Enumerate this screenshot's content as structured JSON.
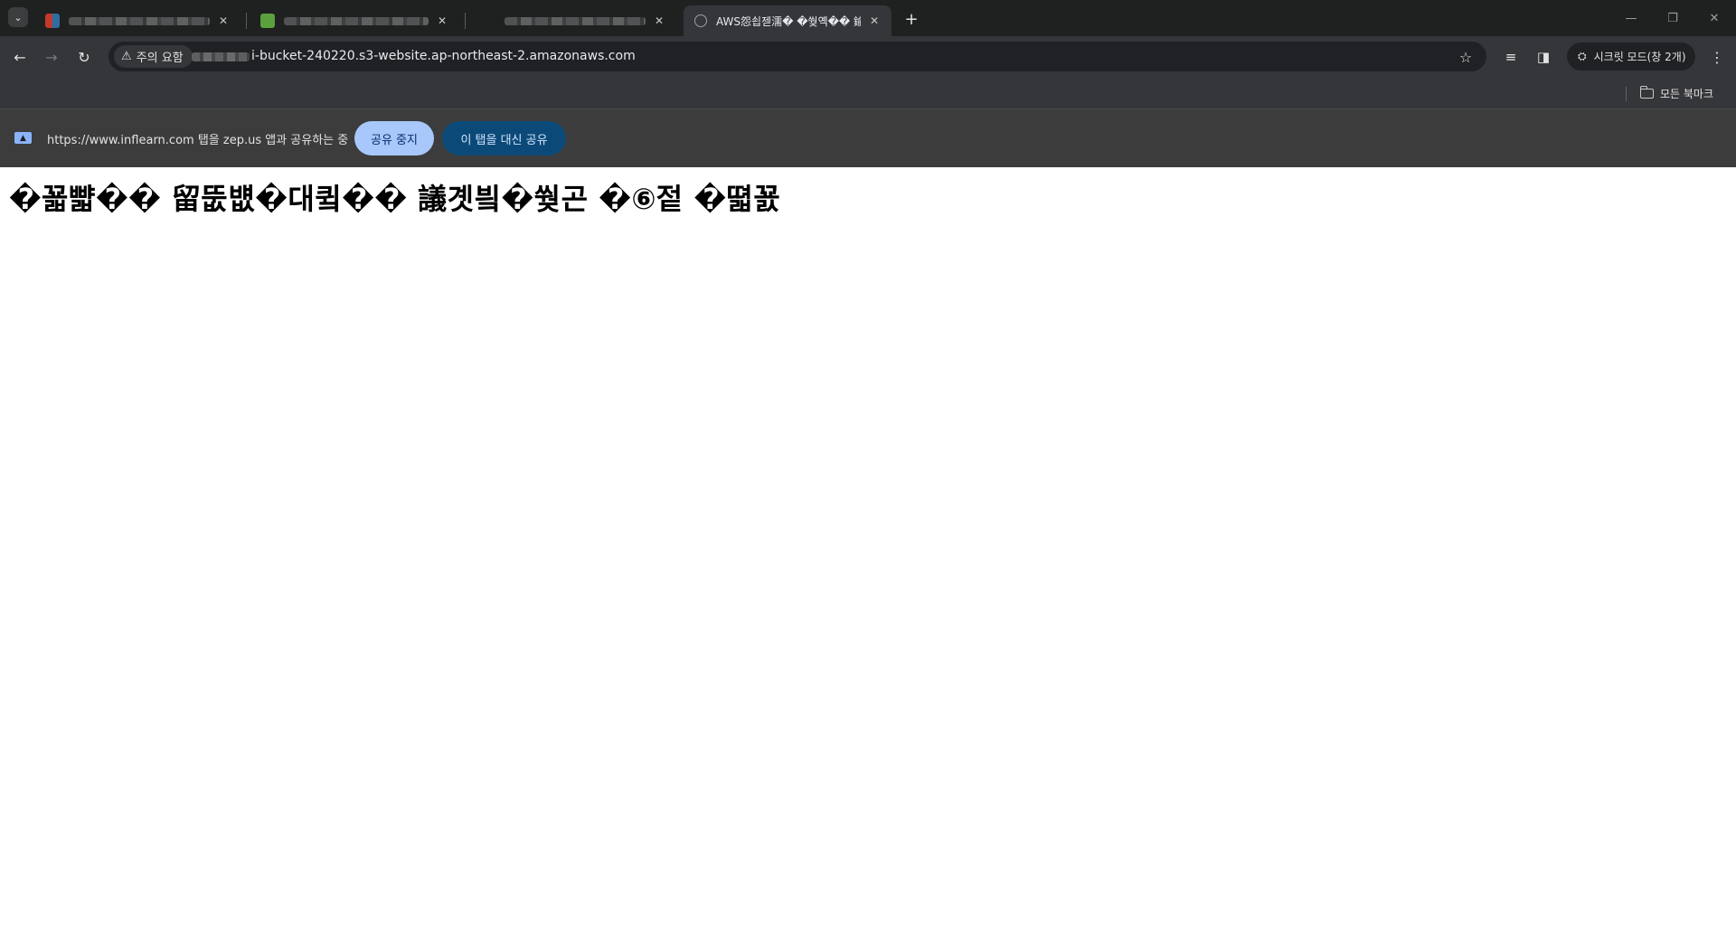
{
  "tabs": [
    {
      "title": "",
      "favicon_color": "#c0392b",
      "blurred": true
    },
    {
      "title": "",
      "favicon_color": "#5aa03c",
      "blurred": true
    },
    {
      "title": "",
      "favicon_color": "",
      "blurred": true
    },
    {
      "title": "AWS怨쇱젣濡� �쒖옉�� 鍮",
      "favicon_color": "",
      "blurred": false,
      "active": true
    }
  ],
  "icons": {
    "tab_search": "⌄",
    "close": "✕",
    "new_tab": "+",
    "minimize": "—",
    "restore": "❐",
    "window_close": "✕",
    "back": "←",
    "forward": "→",
    "reload": "↻",
    "warning": "⚠",
    "star": "☆",
    "media_controls": "≡",
    "side_panel": "◨",
    "incognito": "⛭",
    "menu": "⋮",
    "share_screen": "▲"
  },
  "toolbar": {
    "security_label": "주의 요함",
    "url": "i-bucket-240220.s3-website.ap-northeast-2.amazonaws.com",
    "incognito_label": "시크릿 모드(창 2개)"
  },
  "bookmarks": {
    "all_bookmarks_label": "모든 북마크"
  },
  "infobar": {
    "message": "https://www.inflearn.com 탭을 zep.us 앱과 공유하는 중",
    "stop_button": "공유 중지",
    "share_this_button": "이 탭을 대신 공유"
  },
  "page": {
    "heading": "�꾧뺣�� 留뚮뱺�대큌�� 議곗빀�쒖곤 �⑥젙 �뗣꾨"
  }
}
